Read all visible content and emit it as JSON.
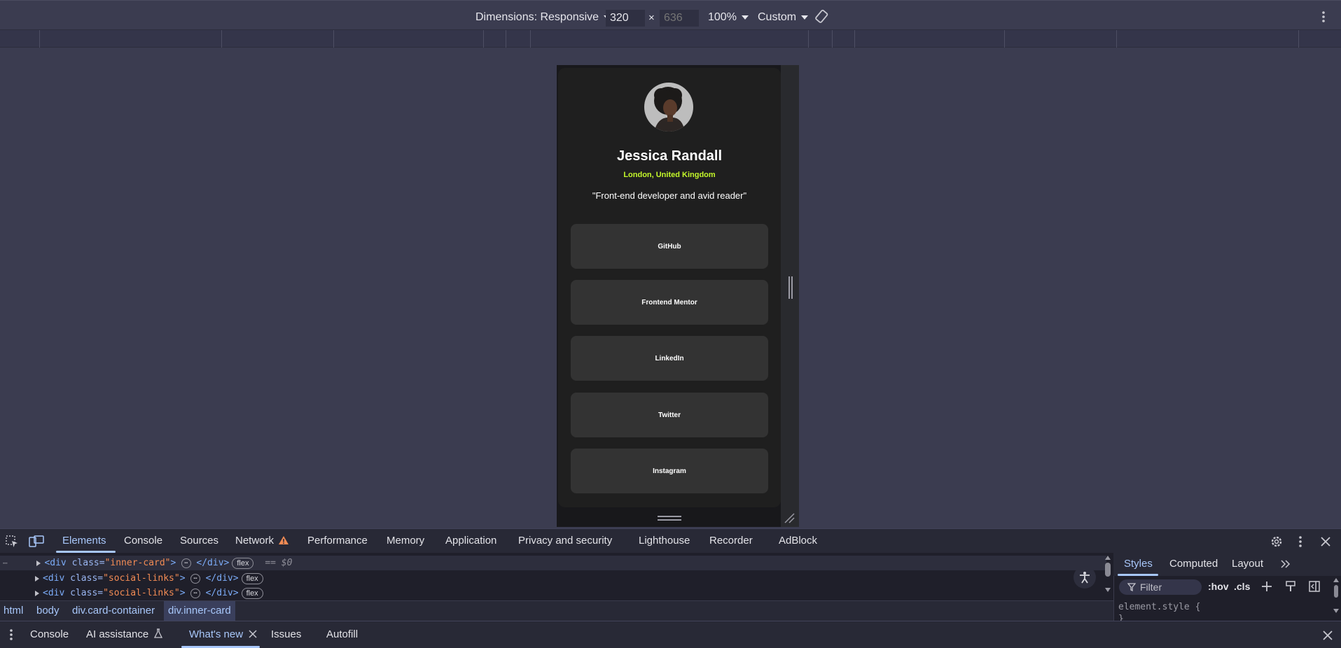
{
  "device_toolbar": {
    "dimensions_label": "Dimensions: Responsive",
    "width_value": "320",
    "height_placeholder": "636",
    "times": "×",
    "zoom": "100%",
    "throttle": "Custom"
  },
  "profile": {
    "name": "Jessica Randall",
    "location": "London, United Kingdom",
    "bio": "\"Front-end developer and avid reader\"",
    "links": [
      "GitHub",
      "Frontend Mentor",
      "LinkedIn",
      "Twitter",
      "Instagram"
    ],
    "accent_color": "#c4f82a"
  },
  "devtools": {
    "tabs": [
      "Elements",
      "Console",
      "Sources",
      "Network",
      "Performance",
      "Memory",
      "Application",
      "Privacy and security",
      "Lighthouse",
      "Recorder",
      "AdBlock"
    ],
    "active_tab": "Elements",
    "elements": [
      {
        "tag_open": "<div",
        "attr": "class=",
        "value": "\"inner-card\"",
        "close": "> ",
        "ellipsis": "⋯",
        "end": " </div>",
        "badge": "flex",
        "extra": "== $0"
      },
      {
        "tag_open": "<div",
        "attr": "class=",
        "value": "\"social-links\"",
        "close": "> ",
        "ellipsis": "⋯",
        "end": " </div>",
        "badge": "flex",
        "extra": ""
      },
      {
        "tag_open": "<div",
        "attr": "class=",
        "value": "\"social-links\"",
        "close": "> ",
        "ellipsis": "⋯",
        "end": " </div>",
        "badge": "flex",
        "extra": ""
      }
    ],
    "breadcrumb": [
      "html",
      "body",
      "div.card-container",
      "div.inner-card"
    ],
    "styles_tabs": [
      "Styles",
      "Computed",
      "Layout"
    ],
    "filter_placeholder": "Filter",
    "hov": ":hov",
    "cls": ".cls",
    "element_style": "element.style {",
    "element_style_close": "}"
  },
  "drawer": {
    "tabs": [
      "Console",
      "AI assistance",
      "What's new",
      "Issues",
      "Autofill"
    ],
    "active_tab": "What's new"
  }
}
